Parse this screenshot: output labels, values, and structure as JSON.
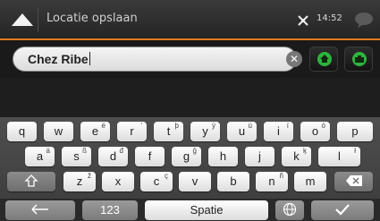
{
  "header": {
    "title": "Locatie opslaan",
    "time": "14:52"
  },
  "search": {
    "value": "Chez Ribe"
  },
  "keyboard": {
    "row1": [
      [
        "q",
        ""
      ],
      [
        "w",
        ""
      ],
      [
        "e",
        "é"
      ],
      [
        "r",
        "'"
      ],
      [
        "t",
        "þ"
      ],
      [
        "y",
        "ÿ"
      ],
      [
        "u",
        "ü"
      ],
      [
        "i",
        "í"
      ],
      [
        "o",
        "ó"
      ],
      [
        "p",
        ""
      ]
    ],
    "row2": [
      [
        "a",
        "ä"
      ],
      [
        "s",
        "ß"
      ],
      [
        "d",
        "đ"
      ],
      [
        "f",
        ""
      ],
      [
        "g",
        "ğ"
      ],
      [
        "h",
        ""
      ],
      [
        "j",
        ""
      ],
      [
        "k",
        "ķ"
      ],
      [
        "l",
        "ł"
      ]
    ],
    "row3": [
      [
        "z",
        "ž"
      ],
      [
        "x",
        ""
      ],
      [
        "c",
        "ç"
      ],
      [
        "v",
        ""
      ],
      [
        "b",
        ""
      ],
      [
        "n",
        "ñ"
      ],
      [
        "m",
        ""
      ]
    ],
    "numbers_label": "123",
    "space_label": "Spatie"
  }
}
